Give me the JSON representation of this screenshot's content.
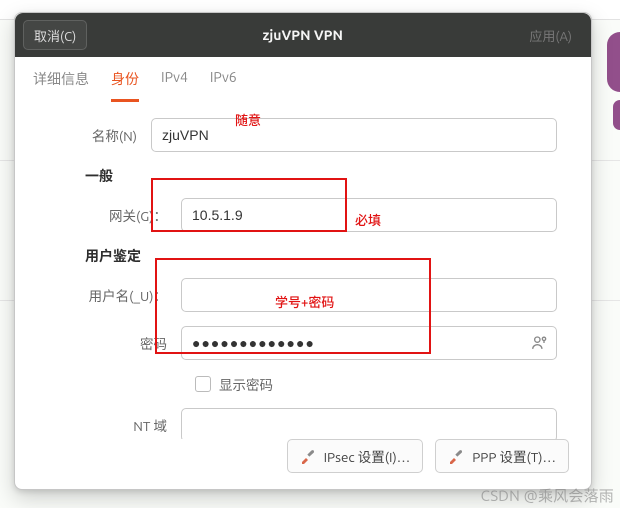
{
  "header": {
    "cancel_label": "取消(C)",
    "title": "zjuVPN VPN",
    "apply_label": "应用(A)"
  },
  "tabs": {
    "details": "详细信息",
    "identity": "身份",
    "ipv4": "IPv4",
    "ipv6": "IPv6"
  },
  "form": {
    "name_label": "名称(N)",
    "name_value": "zjuVPN",
    "section_general": "一般",
    "gateway_label": "网关(G)：",
    "gateway_value": "10.5.1.9",
    "section_auth": "用户鉴定",
    "username_label": "用户名(_U)：",
    "username_value": "",
    "password_label": "密码",
    "password_value": "●●●●●●●●●●●●●",
    "show_password_label": "显示密码",
    "ntdomain_label": "NT 域",
    "ntdomain_value": ""
  },
  "buttons": {
    "ipsec": "IPsec 设置(I)…",
    "ppp": "PPP 设置(T)…"
  },
  "annotations": {
    "free_label": "随意",
    "required_label": "必填",
    "credentials_label": "学号+密码"
  },
  "watermark": "CSDN @乘风会落雨"
}
